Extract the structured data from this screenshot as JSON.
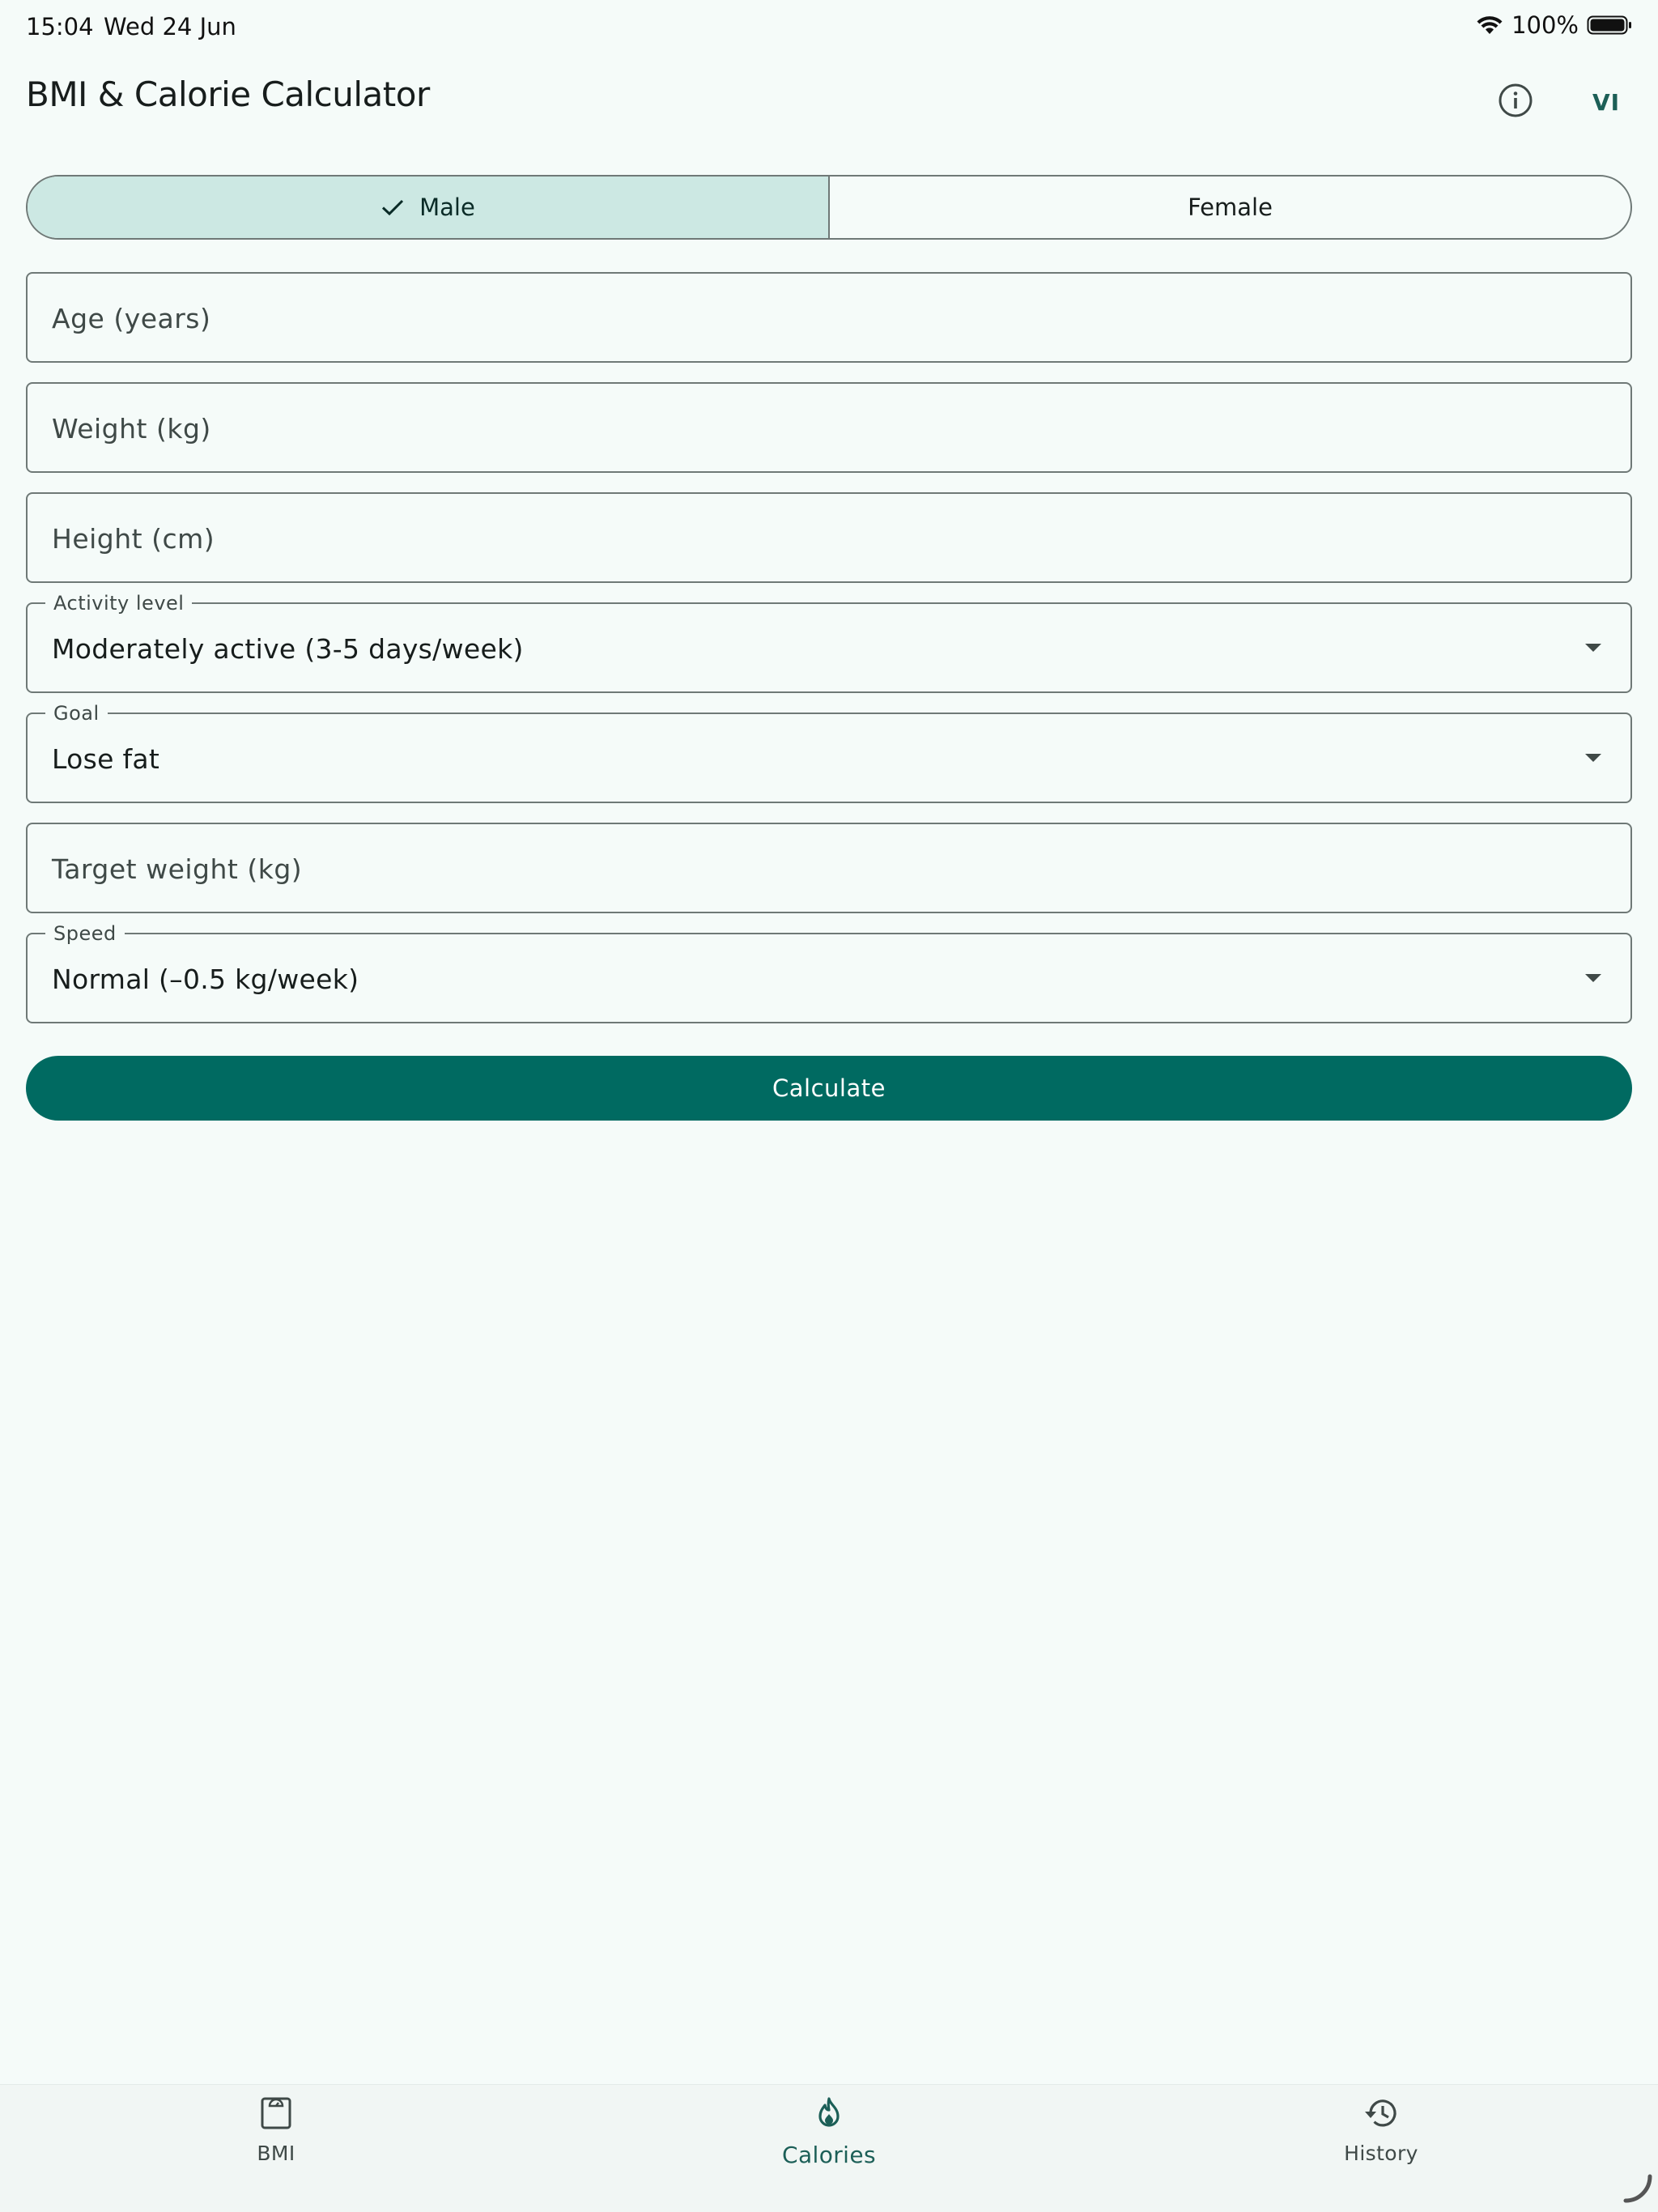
{
  "status": {
    "time": "15:04",
    "date": "Wed 24 Jun",
    "battery": "100%"
  },
  "app": {
    "title": "BMI & Calorie Calculator",
    "lang_label": "VI"
  },
  "gender": {
    "male_label": "Male",
    "female_label": "Female",
    "selected": "Male"
  },
  "fields": {
    "age": {
      "placeholder": "Age (years)"
    },
    "weight": {
      "placeholder": "Weight (kg)"
    },
    "height": {
      "placeholder": "Height (cm)"
    },
    "activity": {
      "label": "Activity level",
      "value": "Moderately active (3-5 days/week)"
    },
    "goal": {
      "label": "Goal",
      "value": "Lose fat"
    },
    "target_weight": {
      "placeholder": "Target weight (kg)"
    },
    "speed": {
      "label": "Speed",
      "value": "Normal (–0.5 kg/week)"
    }
  },
  "actions": {
    "calculate_label": "Calculate"
  },
  "nav": {
    "items": [
      {
        "label": "BMI",
        "icon": "scale-icon"
      },
      {
        "label": "Calories",
        "icon": "flame-icon",
        "active": true
      },
      {
        "label": "History",
        "icon": "history-icon"
      }
    ]
  },
  "colors": {
    "primary": "#006a61",
    "selected_segment": "#cce8e3",
    "background": "#f5fbf9",
    "outline": "#6f7977"
  }
}
